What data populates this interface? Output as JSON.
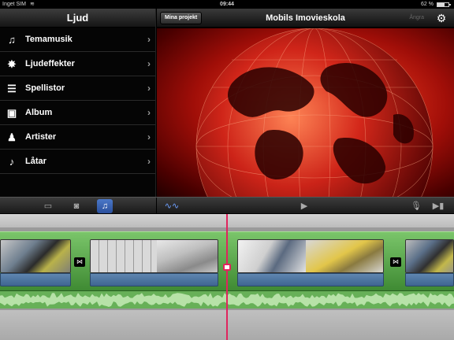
{
  "status": {
    "carrier": "Inget SIM",
    "time": "09:44",
    "battery_pct": "62 %",
    "battery_level": 0.62
  },
  "sidebar": {
    "title": "Ljud",
    "items": [
      {
        "label": "Temamusik",
        "icon": "music-note-icon"
      },
      {
        "label": "Ljudeffekter",
        "icon": "burst-icon"
      },
      {
        "label": "Spellistor",
        "icon": "playlist-icon"
      },
      {
        "label": "Album",
        "icon": "album-icon"
      },
      {
        "label": "Artister",
        "icon": "artist-icon"
      },
      {
        "label": "Låtar",
        "icon": "song-icon"
      }
    ]
  },
  "header": {
    "projects_button": "Mina projekt",
    "title": "Mobils Imovieskola",
    "undo": "Ångra"
  },
  "colors": {
    "accent_blue": "#3a64b8",
    "timeline_green": "#5aa84b",
    "playhead": "#e0245e"
  }
}
